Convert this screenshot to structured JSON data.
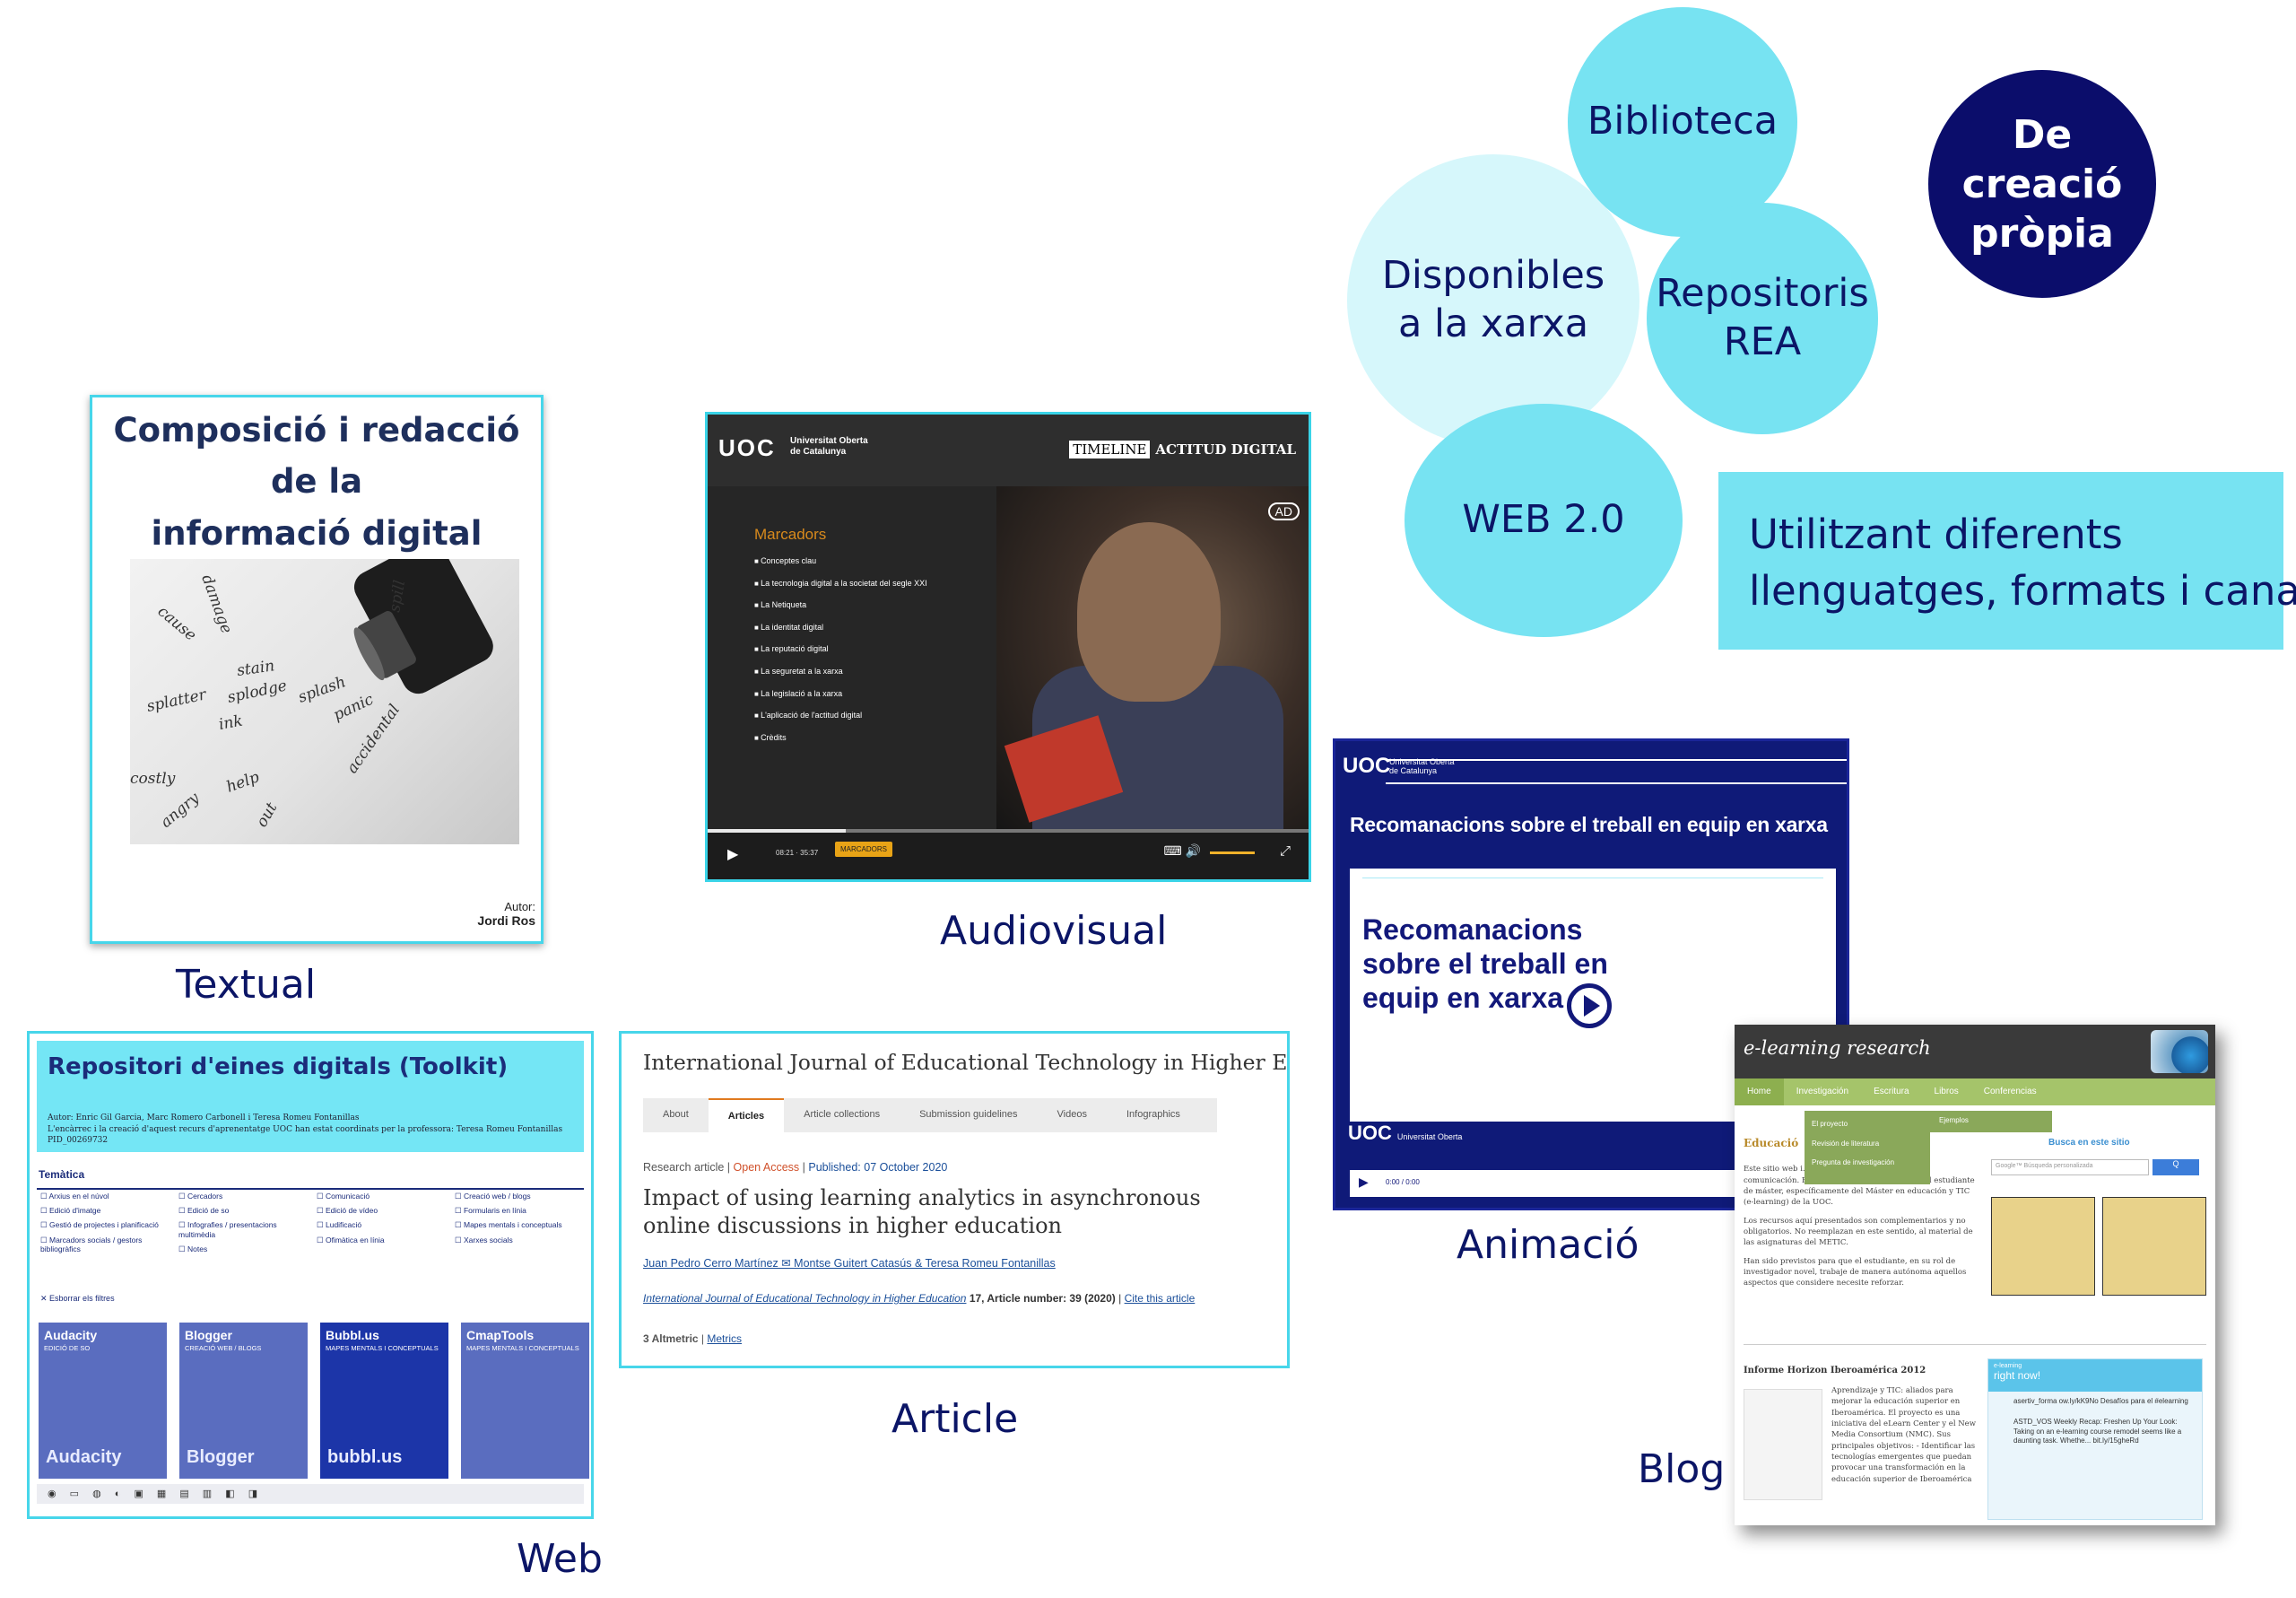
{
  "bubbles": {
    "disponibles": "Disponibles a la xarxa",
    "disponibles_l1": "Disponibles",
    "disponibles_l2": "a la xarxa",
    "biblioteca": "Biblioteca",
    "repositoris_l1": "Repositoris",
    "repositoris_l2": "REA",
    "web20": "WEB 2.0",
    "propia_l1": "De creació",
    "propia_l2": "pròpia"
  },
  "languages_box": {
    "line1": "Utilitzant diferents",
    "line2": "llenguatges, formats i canals."
  },
  "captions": {
    "textual": "Textual",
    "audiovisual": "Audiovisual",
    "animacio": "Animació",
    "web": "Web",
    "article": "Article",
    "blog": "Blog"
  },
  "textual": {
    "title_l1": "Composició i redacció de la",
    "title_l2": "informació digital",
    "author_label": "Autor:",
    "author_name": "Jordi Ros",
    "photo_words": [
      "splatter",
      "splodge",
      "stain",
      "ink",
      "splash",
      "spill",
      "panic",
      "accidental",
      "help",
      "angry",
      "out",
      "costly",
      "cause",
      "damage"
    ]
  },
  "audiovisual": {
    "logo": "UOC",
    "university_l1": "Universitat Oberta",
    "university_l2": "de Catalunya",
    "timeline_tag": "TIMELINE",
    "timeline_rest": "ACTITUD DIGITAL",
    "menu_heading": "Marcadors",
    "menu_items": [
      "Conceptes clau",
      "La tecnologia digital a la societat del segle XXI",
      "La Netiqueta",
      "La identitat digital",
      "La reputació digital",
      "La seguretat a la xarxa",
      "La legislació a la xarxa",
      "L'aplicació de l'actitud digital",
      "Crèdits"
    ],
    "badge": "AD",
    "time": "08:21 · 35:37",
    "markers_button": "MARCADORS",
    "progress_fraction": 0.23
  },
  "animacio": {
    "logo": "UOC",
    "university_l1": "Universitat Oberta",
    "university_l2": "de Catalunya",
    "title": "Recomanacions sobre el treball en equip en xarxa",
    "card_title": "Recomanacions sobre el treball en equip en xarxa",
    "time": "0:00 / 0:00"
  },
  "web": {
    "title": "Repositori d'eines digitals (Toolkit)",
    "meta_l1": "Autor: Enric Gil Garcia, Marc Romero Carbonell i Teresa Romeu Fontanillas",
    "meta_l2": "L'encàrrec i la creació d'aquest recurs d'aprenentatge UOC han estat coordinats per la professora: Teresa Romeu Fontanillas",
    "meta_l3": "PID_00269732",
    "section": "Temàtica",
    "filters": [
      [
        "Arxius en el núvol",
        "Edició d'imatge",
        "Gestió de projectes i planificació",
        "Marcadors socials / gestors bibliogràfics"
      ],
      [
        "Cercadors",
        "Edició de so",
        "Infografies / presentacions multimèdia",
        "Notes"
      ],
      [
        "Comunicació",
        "Edició de vídeo",
        "Ludificació",
        "Ofimàtica en línia"
      ],
      [
        "Creació web / blogs",
        "Formularis en línia",
        "Mapes mentals i conceptuals",
        "Xarxes socials"
      ]
    ],
    "clear_filters": "Esborrar els filtres",
    "cards": [
      {
        "name": "Audacity",
        "sub": "EDICIÓ DE SO",
        "logo": "Audacity"
      },
      {
        "name": "Blogger",
        "sub": "CREACIÓ WEB / BLOGS",
        "logo": "Blogger"
      },
      {
        "name": "Bubbl.us",
        "sub": "MAPES MENTALS I CONCEPTUALS",
        "logo": "bubbl.us"
      },
      {
        "name": "CmapTools",
        "sub": "MAPES MENTALS I CONCEPTUALS",
        "logo": ""
      }
    ]
  },
  "article": {
    "journal": "International Journal of Educational Technology in Higher Education",
    "tabs": [
      "About",
      "Articles",
      "Article collections",
      "Submission guidelines",
      "Videos",
      "Infographics"
    ],
    "type": "Research article",
    "open_access": "Open Access",
    "published": "Published: 07 October 2020",
    "title": "Impact of using learning analytics in asynchronous online discussions in higher education",
    "authors": "Juan Pedro Cerro Martínez ✉  Montse Guitert Catasús & Teresa Romeu Fontanillas",
    "citation_journal": "International Journal of Educational Technology in Higher Education",
    "citation_rest": "17, Article number: 39 (2020)",
    "cite_link": "Cite this article",
    "altmetric": "3 Altmetric",
    "metrics": "Metrics"
  },
  "blog": {
    "title": "e-learning research",
    "nav": [
      "Home",
      "Investigación",
      "Escritura",
      "Libros",
      "Conferencias"
    ],
    "dropdown": [
      "El proyecto",
      "Revisión de literatura",
      "Pregunta de investigación"
    ],
    "dropdown2": "Ejemplos",
    "section_head": "Educació",
    "para1": "Este sitio web i... información acerca de un p... comunicación. Está orientado a brindar apoyo al estudiante de máster, específicamente del Máster en educación y TIC (e-learning) de la UOC.",
    "para2": "Los recursos aquí presentados son complementarios y no obligatorios. No reemplazan en este sentido, al material de las asignaturas del METIC.",
    "para3": "Han sido previstos para que el estudiante, en su rol de investigador novel, trabaje de manera autónoma aquellos aspectos que considere necesite reforzar.",
    "search_head": "Busca en este sitio",
    "search_placeholder": "Google™ Búsqueda personalizada",
    "search_button": "Q",
    "horizon_head": "Informe Horizon Iberoamérica 2012",
    "horizon_text": "Aprendizaje y TIC: aliados para mejorar la educación superior en Iberoamérica. El proyecto es una iniciativa del eLearn Center y el New Media Consortium (NMC). Sus principales objetivos: - Identificar las tecnologías emergentes que puedan provocar una transformación en la educación superior de Iberoamérica",
    "twitter_small": "e-learning",
    "twitter_head": "right now!",
    "tweets": [
      "asertiv_forma ow.ly/kK9No Desafíos para el #elearning",
      "ASTD_VOS Weekly Recap: Freshen Up Your Look: Taking on an e-learning course remodel seems like a daunting task. Whethe... bit.ly/15gheRd"
    ]
  },
  "colors": {
    "light_cyan": "#d6f7fb",
    "cyan": "#77e3f2",
    "navy": "#0b0d6b",
    "text_blue": "#0b1566"
  }
}
